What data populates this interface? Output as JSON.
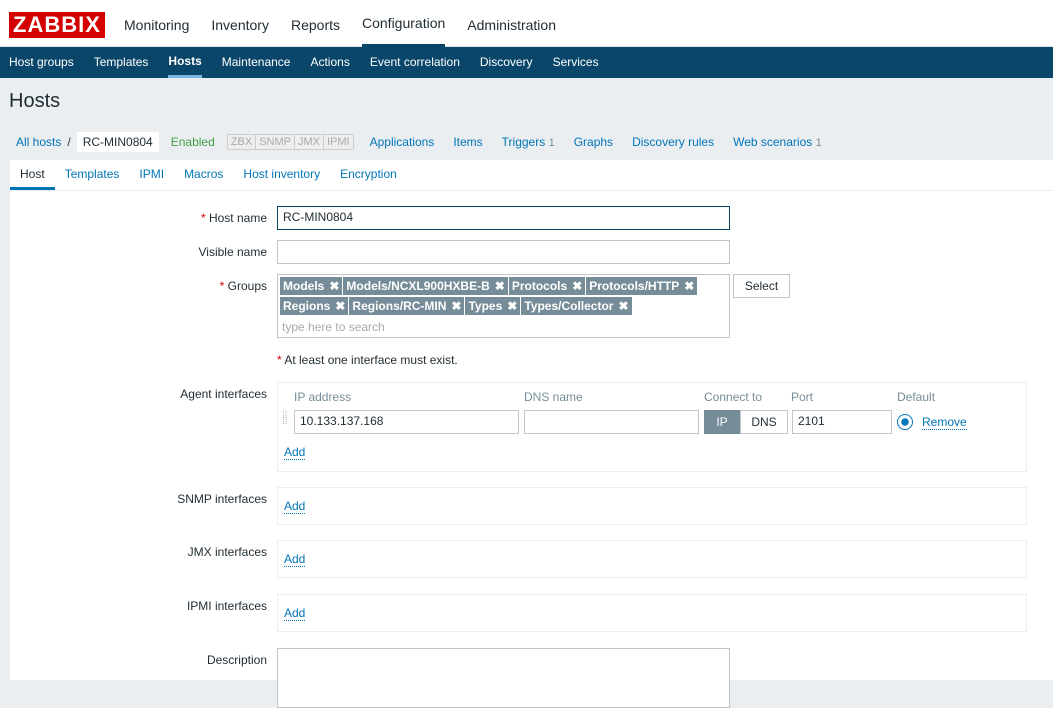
{
  "logo": "ZABBIX",
  "main_menu": [
    "Monitoring",
    "Inventory",
    "Reports",
    "Configuration",
    "Administration"
  ],
  "sub_menu": [
    "Host groups",
    "Templates",
    "Hosts",
    "Maintenance",
    "Actions",
    "Event correlation",
    "Discovery",
    "Services"
  ],
  "title": "Hosts",
  "breadcrumb": {
    "all": "All hosts",
    "sep": "/",
    "host": "RC-MIN0804",
    "status": "Enabled",
    "avail": [
      "ZBX",
      "SNMP",
      "JMX",
      "IPMI"
    ],
    "links": [
      {
        "label": "Applications",
        "count": ""
      },
      {
        "label": "Items",
        "count": ""
      },
      {
        "label": "Triggers",
        "count": "1"
      },
      {
        "label": "Graphs",
        "count": ""
      },
      {
        "label": "Discovery rules",
        "count": ""
      },
      {
        "label": "Web scenarios",
        "count": "1"
      }
    ]
  },
  "tabs": [
    "Host",
    "Templates",
    "IPMI",
    "Macros",
    "Host inventory",
    "Encryption"
  ],
  "form": {
    "host_name_label": "Host name",
    "host_name": "RC-MIN0804",
    "visible_name_label": "Visible name",
    "visible_name": "",
    "groups_label": "Groups",
    "groups": [
      "Models",
      "Models/NCXL900HXBE-B",
      "Protocols",
      "Protocols/HTTP",
      "Regions",
      "Regions/RC-MIN",
      "Types",
      "Types/Collector"
    ],
    "groups_placeholder": "type here to search",
    "select": "Select",
    "remove_x": "✖",
    "interface_note": "At least one interface must exist.",
    "agent_label": "Agent interfaces",
    "cols": [
      "IP address",
      "DNS name",
      "Connect to",
      "Port",
      "Default"
    ],
    "ip": "10.133.137.168",
    "dns": "",
    "connect_ip": "IP",
    "connect_dns": "DNS",
    "port": "2101",
    "remove": "Remove",
    "add": "Add",
    "snmp_label": "SNMP interfaces",
    "jmx_label": "JMX interfaces",
    "ipmi_label": "IPMI interfaces",
    "description_label": "Description"
  }
}
